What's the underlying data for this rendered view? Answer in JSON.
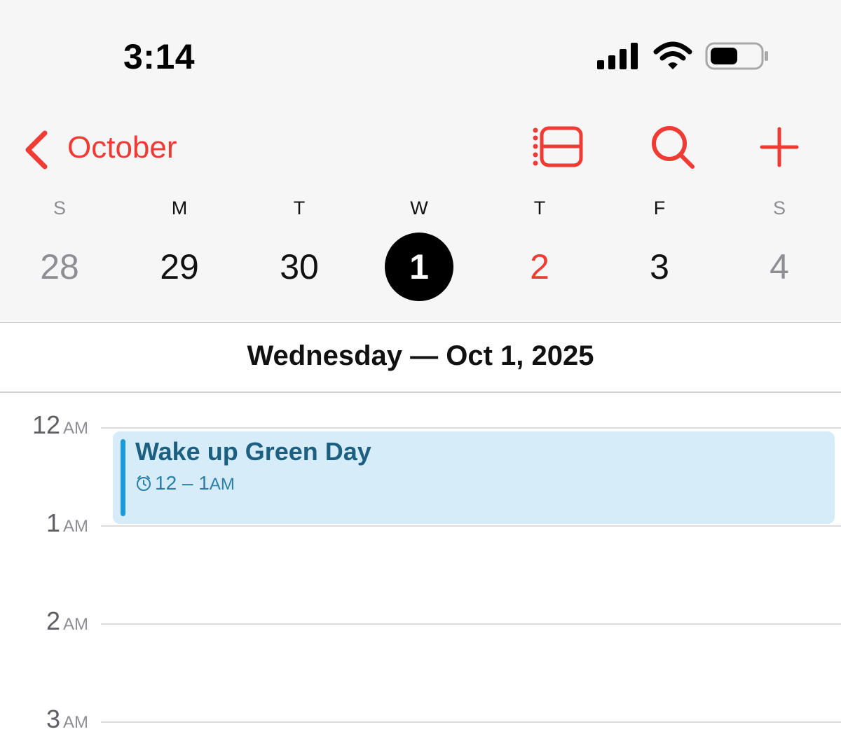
{
  "status_bar": {
    "time": "3:14",
    "icons": [
      "cellular-signal-icon",
      "wifi-icon",
      "battery-icon"
    ]
  },
  "nav": {
    "back_label": "October",
    "accent_color": "#ef3b33",
    "buttons": [
      "list-view-icon",
      "search-icon",
      "add-icon"
    ]
  },
  "week": {
    "days": [
      {
        "letter": "S",
        "num": "28",
        "state": "weekend"
      },
      {
        "letter": "M",
        "num": "29",
        "state": "normal"
      },
      {
        "letter": "T",
        "num": "30",
        "state": "normal"
      },
      {
        "letter": "W",
        "num": "1",
        "state": "selected"
      },
      {
        "letter": "T",
        "num": "2",
        "state": "today"
      },
      {
        "letter": "F",
        "num": "3",
        "state": "normal"
      },
      {
        "letter": "S",
        "num": "4",
        "state": "weekend"
      }
    ]
  },
  "day_title": "Wednesday — Oct 1, 2025",
  "hours": [
    {
      "num": "12",
      "ampm": "AM"
    },
    {
      "num": "1",
      "ampm": "AM"
    },
    {
      "num": "2",
      "ampm": "AM"
    },
    {
      "num": "3",
      "ampm": "AM"
    }
  ],
  "event": {
    "title": "Wake up Green Day",
    "time_range": "12 – 1",
    "time_suffix": "AM",
    "color": "#1a9ad6",
    "icon": "alarm-clock-icon"
  }
}
